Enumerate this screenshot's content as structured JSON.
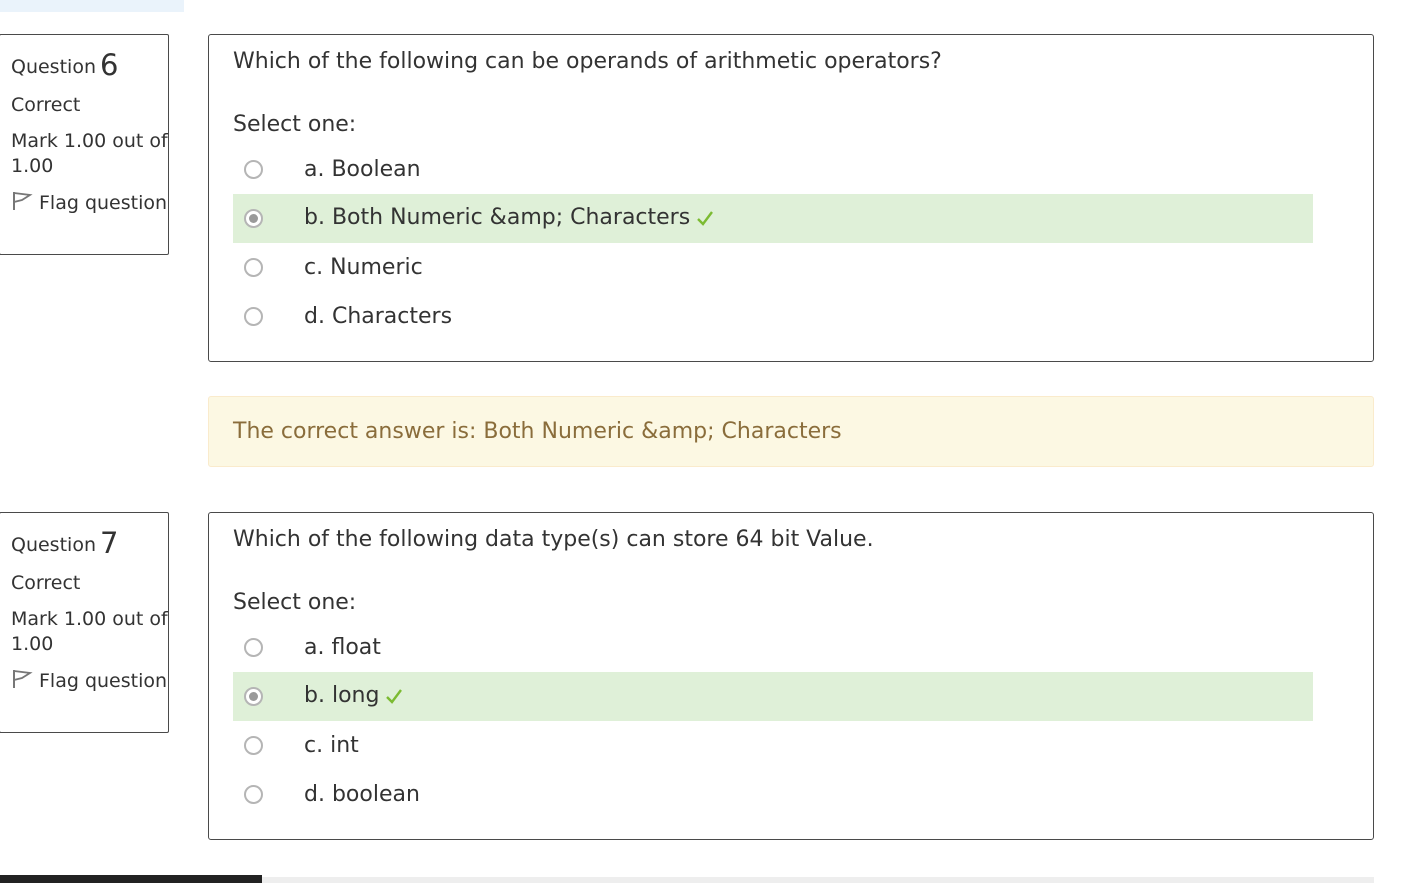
{
  "questions": [
    {
      "label": "Question",
      "number": "6",
      "state": "Correct",
      "grade": "Mark 1.00 out of 1.00",
      "flag": "Flag question",
      "text": "Which of the following can be operands of arithmetic operators?",
      "prompt": "Select one:",
      "options": [
        {
          "label": "a. Boolean",
          "selected": false,
          "correct": false
        },
        {
          "label": "b. Both Numeric &amp; Characters",
          "selected": true,
          "correct": true
        },
        {
          "label": "c. Numeric",
          "selected": false,
          "correct": false
        },
        {
          "label": "d. Characters",
          "selected": false,
          "correct": false
        }
      ],
      "feedback": "The correct answer is: Both Numeric &amp; Characters"
    },
    {
      "label": "Question",
      "number": "7",
      "state": "Correct",
      "grade": "Mark 1.00 out of 1.00",
      "flag": "Flag question",
      "text": "Which of the following data type(s) can store 64 bit Value.",
      "prompt": "Select one:",
      "options": [
        {
          "label": "a. float",
          "selected": false,
          "correct": false
        },
        {
          "label": "b. long",
          "selected": true,
          "correct": true
        },
        {
          "label": "c. int",
          "selected": false,
          "correct": false
        },
        {
          "label": "d. boolean",
          "selected": false,
          "correct": false
        }
      ]
    }
  ],
  "colors": {
    "correct_bg": "#dff0d8",
    "check": "#7cbb32",
    "feedback_bg": "#fcf8e3",
    "feedback_text": "#8a6d3b"
  },
  "icons": {
    "flag": "flag-icon",
    "check": "check-icon"
  }
}
